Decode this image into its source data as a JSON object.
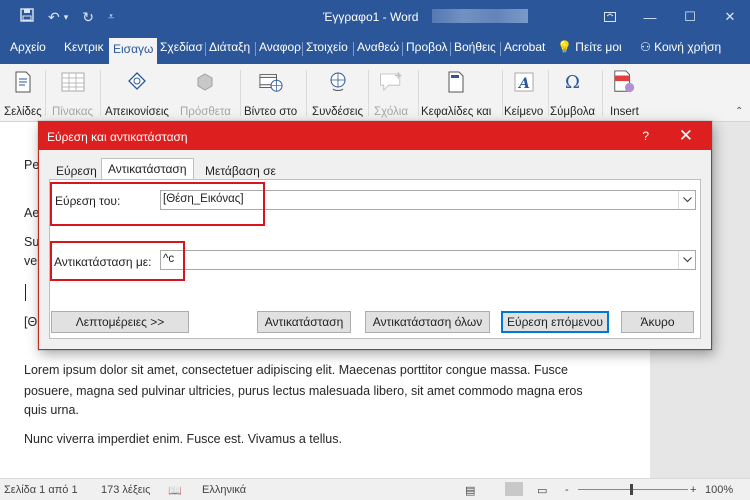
{
  "window": {
    "doc_title": "Έγγραφο1 - Word",
    "controls": [
      "minimize",
      "restore",
      "close"
    ]
  },
  "ribbon_tabs": [
    {
      "label": "Αρχείο"
    },
    {
      "label": "Κεντρικ"
    },
    {
      "label": "Εισαγω"
    },
    {
      "label": "Σχεδίασ"
    },
    {
      "label": "Διάταξη"
    },
    {
      "label": "Αναφορ"
    },
    {
      "label": "Στοιχείο"
    },
    {
      "label": "Αναθεώ"
    },
    {
      "label": "Προβολ"
    },
    {
      "label": "Βοήθεις"
    },
    {
      "label": "Acrobat"
    },
    {
      "label": "Πείτε μοι"
    },
    {
      "label": "Κοινή χρήση"
    }
  ],
  "ribbon_groups": [
    {
      "label": "Σελίδες",
      "icon": "pages-icon"
    },
    {
      "label": "Πίνακας",
      "icon": "table-icon"
    },
    {
      "label": "Απεικονίσεις",
      "icon": "illustrations-icon"
    },
    {
      "label": "Πρόσθετα",
      "icon": "addins-icon"
    },
    {
      "label": "Βίντεο στο",
      "icon": "online-video-icon"
    },
    {
      "label": "Συνδέσεις",
      "icon": "links-icon"
    },
    {
      "label": "Σχόλια",
      "icon": "comment-icon"
    },
    {
      "label": "Κεφαλίδες και",
      "icon": "header-footer-icon"
    },
    {
      "label": "Κείμενο",
      "icon": "text-icon"
    },
    {
      "label": "Σύμβολα",
      "icon": "symbols-icon"
    },
    {
      "label": "Insert",
      "icon": "insert-icon"
    }
  ],
  "document": {
    "left_fragments": [
      "Pe",
      "Ae",
      "Su",
      "ve",
      "[Θ"
    ],
    "paragraph1": [
      "Lorem ipsum dolor sit amet, consectetuer adipiscing elit. Maecenas porttitor congue massa. Fusce",
      "posuere, magna sed pulvinar ultricies, purus lectus malesuada libero, sit amet commodo magna eros",
      "quis urna."
    ],
    "paragraph2": "Nunc viverra imperdiet enim. Fusce est. Vivamus a tellus."
  },
  "dialog": {
    "title": "Εύρεση και αντικατάσταση",
    "help": "?",
    "close": "✕",
    "tabs": [
      {
        "label": "Εύρεση",
        "active": false
      },
      {
        "label": "Αντικατάσταση",
        "active": true
      },
      {
        "label": "Μετάβαση σε",
        "active": false
      }
    ],
    "find_label": "Εύρεση του:",
    "find_value": "[Θέση_Εικόνας]",
    "replace_label": "Αντικατάσταση με:",
    "replace_value": "^c",
    "buttons": {
      "more": "Λεπτομέρειες >>",
      "replace": "Αντικατάσταση",
      "replace_all": "Αντικατάσταση όλων",
      "find_next": "Εύρεση επόμενου",
      "cancel": "Άκυρο"
    },
    "highlight_color": "#d9141c"
  },
  "status": {
    "page": "Σελίδα 1 από 1",
    "words": "173 λέξεις",
    "language": "Ελληνικά",
    "zoom": "100%",
    "zoom_minus": "-",
    "zoom_plus": "+"
  },
  "colors": {
    "word_blue": "#2b579a",
    "dialog_title": "#dd1f1f"
  }
}
